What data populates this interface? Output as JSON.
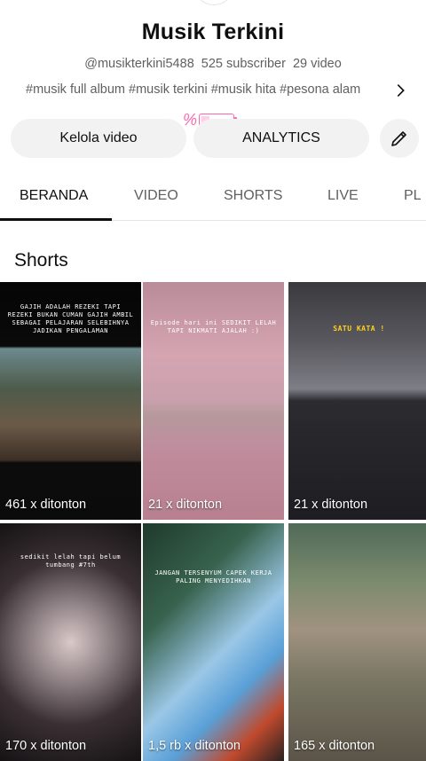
{
  "channel": {
    "title": "Musik Terkini",
    "handle": "@musikterkini5488",
    "subscribers": "525 subscriber",
    "videos": "29 video",
    "hashtags": "#musik full album #musik terkini #musik hita #pesona alam"
  },
  "overlay": {
    "battery_percent_symbol": "%",
    "battery_level": 0.25
  },
  "actions": {
    "manage_label": "Kelola video",
    "analytics_label": "ANALYTICS"
  },
  "tabs": [
    "BERANDA",
    "VIDEO",
    "SHORTS",
    "LIVE",
    "PL"
  ],
  "shorts": {
    "title": "Shorts",
    "items": [
      {
        "views": "461 x ditonton",
        "caption": "GAJIH ADALAH REZEKI TAPI REZEKI BUKAN CUMAN GAJIH AMBIL SEBAGAI PELAJARAN SELEBIHNYA JADIKAN PENGALAMAN"
      },
      {
        "views": "21 x ditonton",
        "caption": "Episode hari ini SEDIKIT LELAH TAPI NIKMATI AJALAH :)"
      },
      {
        "views": "21 x ditonton",
        "caption": "SATU KATA !"
      },
      {
        "views": "170 x ditonton",
        "caption": "sedikit lelah tapi belum tumbang #7th"
      },
      {
        "views": "1,5 rb x ditonton",
        "caption": "JANGAN TERSENYUM CAPEK KERJA PALING MENYEDIHKAN"
      },
      {
        "views": "165 x ditonton",
        "caption": ""
      }
    ]
  },
  "colors": {
    "text_primary": "#0f0f0f",
    "text_secondary": "#606060",
    "button_bg": "#f2f2f2",
    "overlay_pink": "#ff66aa"
  }
}
